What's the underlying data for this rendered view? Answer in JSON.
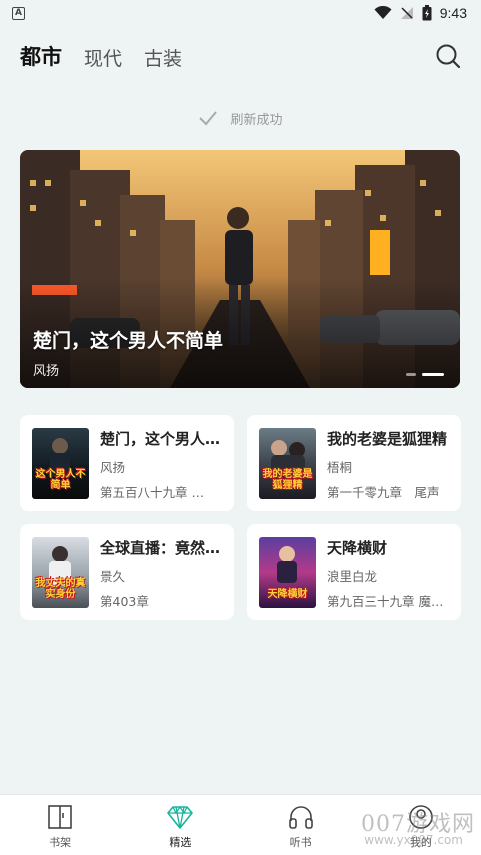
{
  "status_bar": {
    "app_icon_letter": "A",
    "time": "9:43"
  },
  "tabs": [
    {
      "label": "都市",
      "active": true
    },
    {
      "label": "现代",
      "active": false
    },
    {
      "label": "古装",
      "active": false
    }
  ],
  "refresh": {
    "text": "刷新成功"
  },
  "banner": {
    "title": "楚门，这个男人不简单",
    "author": "风扬",
    "page_count": 2,
    "current_page": 2
  },
  "books": [
    {
      "title": "楚门，这个男人不简单",
      "author": "风扬",
      "chapter": "第五百八十九章 …",
      "cover_text": "这个男人不简单"
    },
    {
      "title": "我的老婆是狐狸精",
      "author": "梧桐",
      "chapter": "第一千零九章　尾声",
      "cover_text": "我的老婆是狐狸精"
    },
    {
      "title": "全球直播：竟然…",
      "author": "景久",
      "chapter": "第403章",
      "cover_text": "我丈夫的真实身份"
    },
    {
      "title": "天降横财",
      "author": "浪里白龙",
      "chapter": "第九百三十九章 魔…",
      "cover_text": "天降横财"
    }
  ],
  "bottom_nav": [
    {
      "label": "书架",
      "icon": "bookshelf-icon",
      "active": false
    },
    {
      "label": "精选",
      "icon": "diamond-icon",
      "active": true
    },
    {
      "label": "听书",
      "icon": "headphones-icon",
      "active": false
    },
    {
      "label": "我的",
      "icon": "profile-icon",
      "active": false
    }
  ],
  "watermark": {
    "text": "007游戏网",
    "sub": "www.yx007.com"
  },
  "colors": {
    "accent": "#19b39a",
    "background": "#eef3f3"
  }
}
